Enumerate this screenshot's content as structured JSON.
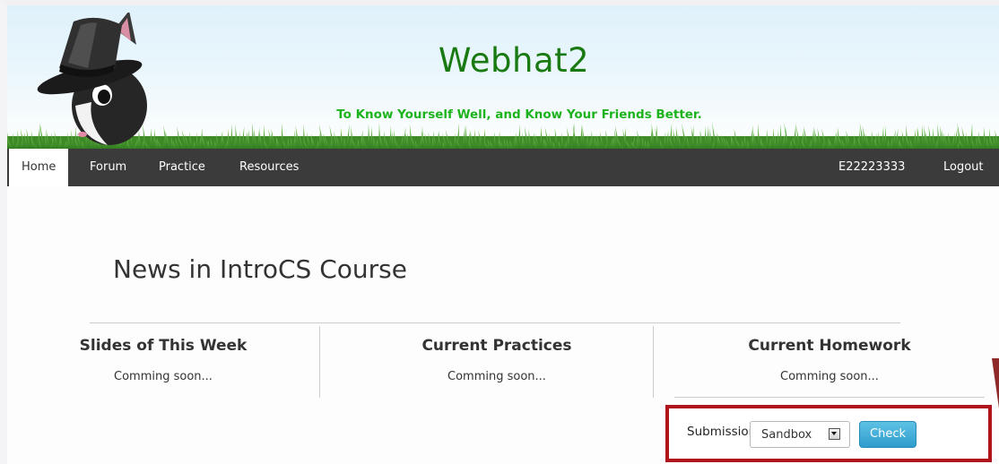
{
  "header": {
    "title": "Webhat2",
    "subtitle": "To Know Yourself Well, and Know Your Friends Better.",
    "logo_icon": "rabbit-top-hat-mascot-icon"
  },
  "nav": {
    "left_items": [
      "Home",
      "Forum",
      "Practice",
      "Resources"
    ],
    "active": "Home",
    "user_id": "E22223333",
    "logout_label": "Logout"
  },
  "main": {
    "news_title": "News in IntroCS Course",
    "columns": [
      {
        "title": "Slides of This Week",
        "text": "Comming soon..."
      },
      {
        "title": "Current Practices",
        "text": "Comming soon..."
      },
      {
        "title": "Current Homework",
        "text": "Comming soon..."
      }
    ]
  },
  "submission": {
    "label": "Submission:",
    "selected": "Sandbox",
    "button_label": "Check"
  },
  "colors": {
    "title_green": "#1a7a12",
    "subtitle_green": "#1db31d",
    "nav_bg": "#3b3b3b",
    "highlight_border": "#b1151c",
    "check_button": "#3aa6d3"
  }
}
